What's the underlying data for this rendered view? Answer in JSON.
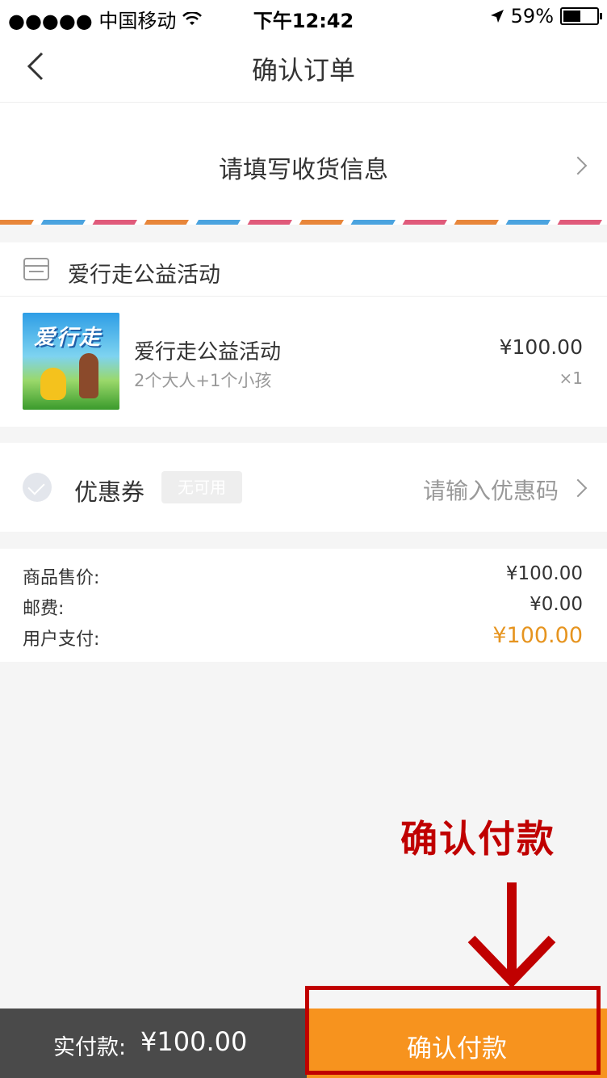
{
  "status_bar": {
    "carrier": "●●●●● 中国移动",
    "time": "下午12:42",
    "battery": "59%",
    "battery_level": 0.59
  },
  "navbar": {
    "title": "确认订单"
  },
  "address": {
    "prompt": "请填写收货信息"
  },
  "shop": {
    "name": "爱行走公益活动",
    "product": {
      "title": "爱行走公益活动",
      "subtitle": "2个大人+1个小孩",
      "price": "¥100.00",
      "quantity": "×1"
    }
  },
  "coupon": {
    "label": "优惠券",
    "badge": "无可用",
    "placeholder": "请输入优惠码"
  },
  "summary": {
    "rows": [
      {
        "label": "商品售价:",
        "value": "¥100.00"
      },
      {
        "label": "邮费:",
        "value": "¥0.00"
      },
      {
        "label": "用户支付:",
        "value": "¥100.00"
      }
    ]
  },
  "annotation": {
    "text": "确认付款",
    "color": "#c00000"
  },
  "bottom_bar": {
    "total_label": "实付款:",
    "total_amount": "¥100.00",
    "confirm_button": "确认付款",
    "button_color": "#f7931e"
  }
}
